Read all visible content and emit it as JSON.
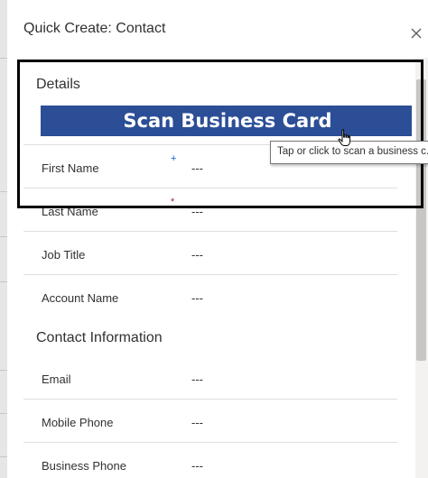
{
  "dialog": {
    "title": "Quick Create: Contact",
    "close_icon": "close-icon"
  },
  "details": {
    "heading": "Details",
    "scan_button_label": "Scan Business Card",
    "fields": [
      {
        "label": "First Name",
        "value": "---",
        "required_marker": "+",
        "marker_color": "#0b5cd5"
      },
      {
        "label": "Last Name",
        "value": "---",
        "required_marker": "*",
        "marker_color": "#a4262c"
      },
      {
        "label": "Job Title",
        "value": "---"
      },
      {
        "label": "Account Name",
        "value": "---"
      }
    ]
  },
  "contact_info": {
    "heading": "Contact Information",
    "fields": [
      {
        "label": "Email",
        "value": "---"
      },
      {
        "label": "Mobile Phone",
        "value": "---"
      },
      {
        "label": "Business Phone",
        "value": "---"
      }
    ]
  },
  "tooltip": {
    "text": "Tap or click to scan a business c..."
  },
  "colors": {
    "scan_button_bg": "#2b4e96",
    "highlight_border": "#000000"
  },
  "icons": {
    "close": "close-icon",
    "cursor": "hand-pointer-icon"
  }
}
